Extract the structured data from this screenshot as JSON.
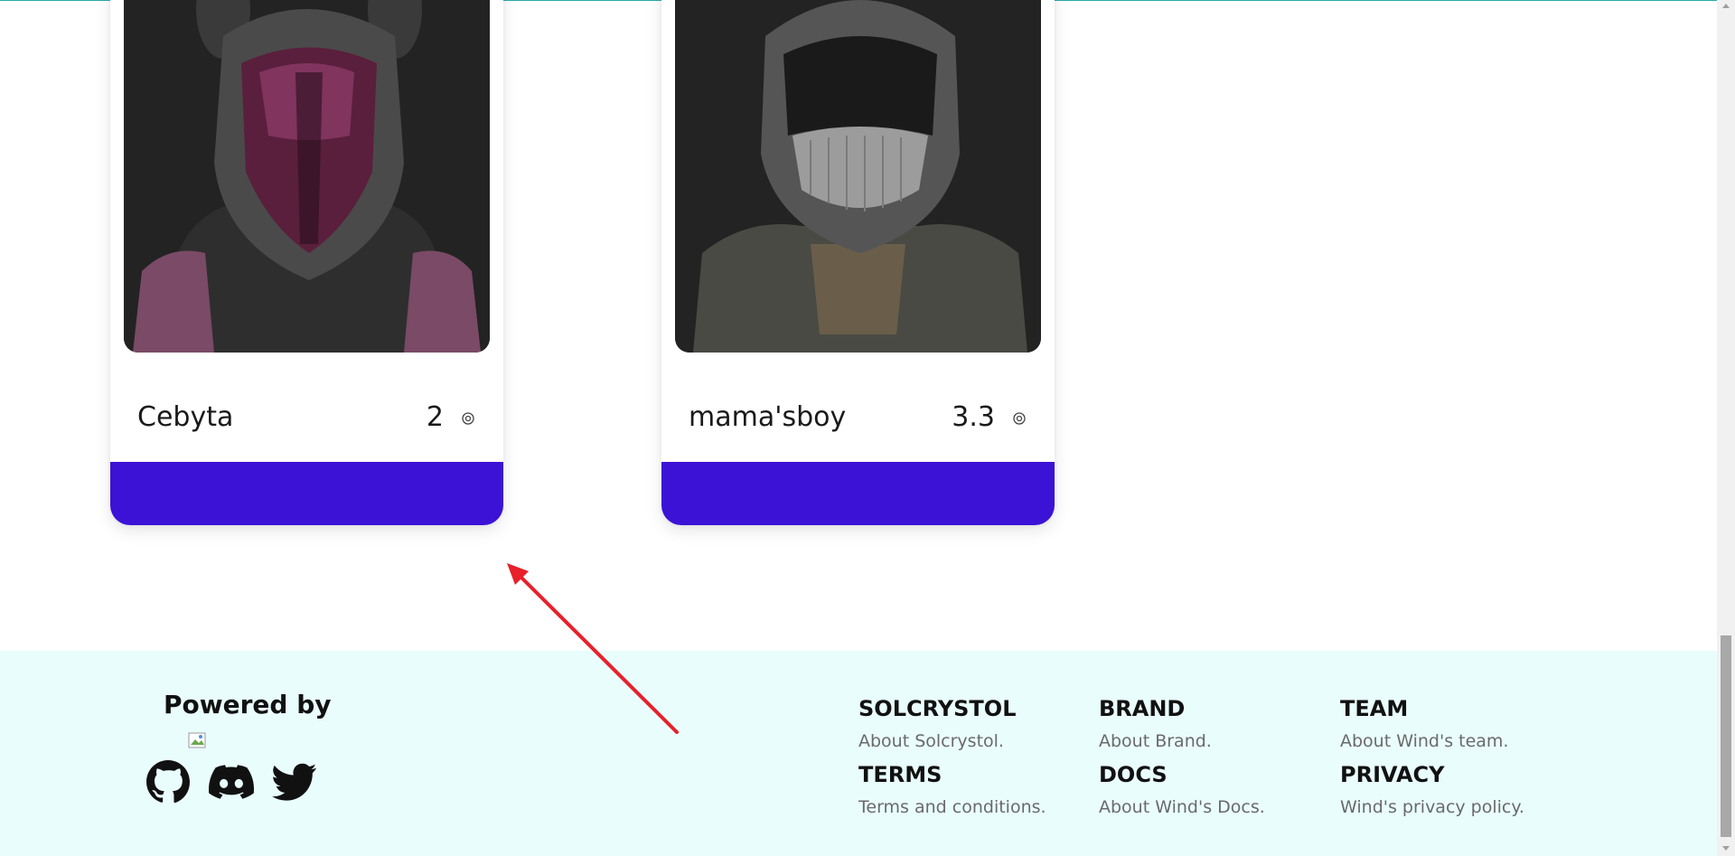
{
  "nft_cards": [
    {
      "name": "Cebyta",
      "price": "2",
      "currency_icon": "coin-icon",
      "image_accent": "#b0407a"
    },
    {
      "name": "mama'sboy",
      "price": "3.3",
      "currency_icon": "coin-icon",
      "image_accent": "#9a9a9a"
    }
  ],
  "colors": {
    "card_bar": "#3b12d6",
    "footer_bg": "#e9fdfc",
    "annotation_arrow": "#e8202a"
  },
  "footer": {
    "powered_by": "Powered by",
    "social_icons": [
      "github-icon",
      "discord-icon",
      "twitter-icon"
    ],
    "links": [
      {
        "title": "SOLCRYSTOL",
        "subtitle": "About Solcrystol."
      },
      {
        "title": "BRAND",
        "subtitle": "About Brand."
      },
      {
        "title": "TEAM",
        "subtitle": "About Wind's team."
      },
      {
        "title": "TERMS",
        "subtitle": "Terms and conditions."
      },
      {
        "title": "DOCS",
        "subtitle": "About Wind's Docs."
      },
      {
        "title": "PRIVACY",
        "subtitle": "Wind's privacy policy."
      }
    ]
  }
}
